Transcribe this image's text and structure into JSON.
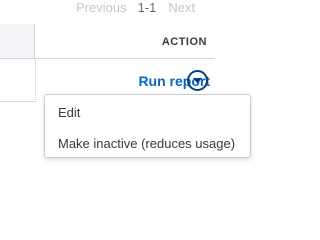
{
  "pagination": {
    "previous_label": "Previous",
    "range": "1-1",
    "next_label": "Next"
  },
  "table": {
    "header_action": "ACTION"
  },
  "row": {
    "run_report_label": "Run report",
    "dropdown_icon": "chevron-down-circle"
  },
  "menu": {
    "items": [
      "Edit",
      "Make inactive (reduces usage)"
    ]
  },
  "colors": {
    "link": "#0a66c2",
    "icon": "#0a3d7a",
    "text": "#393a3d",
    "muted": "#c2c6cc"
  }
}
